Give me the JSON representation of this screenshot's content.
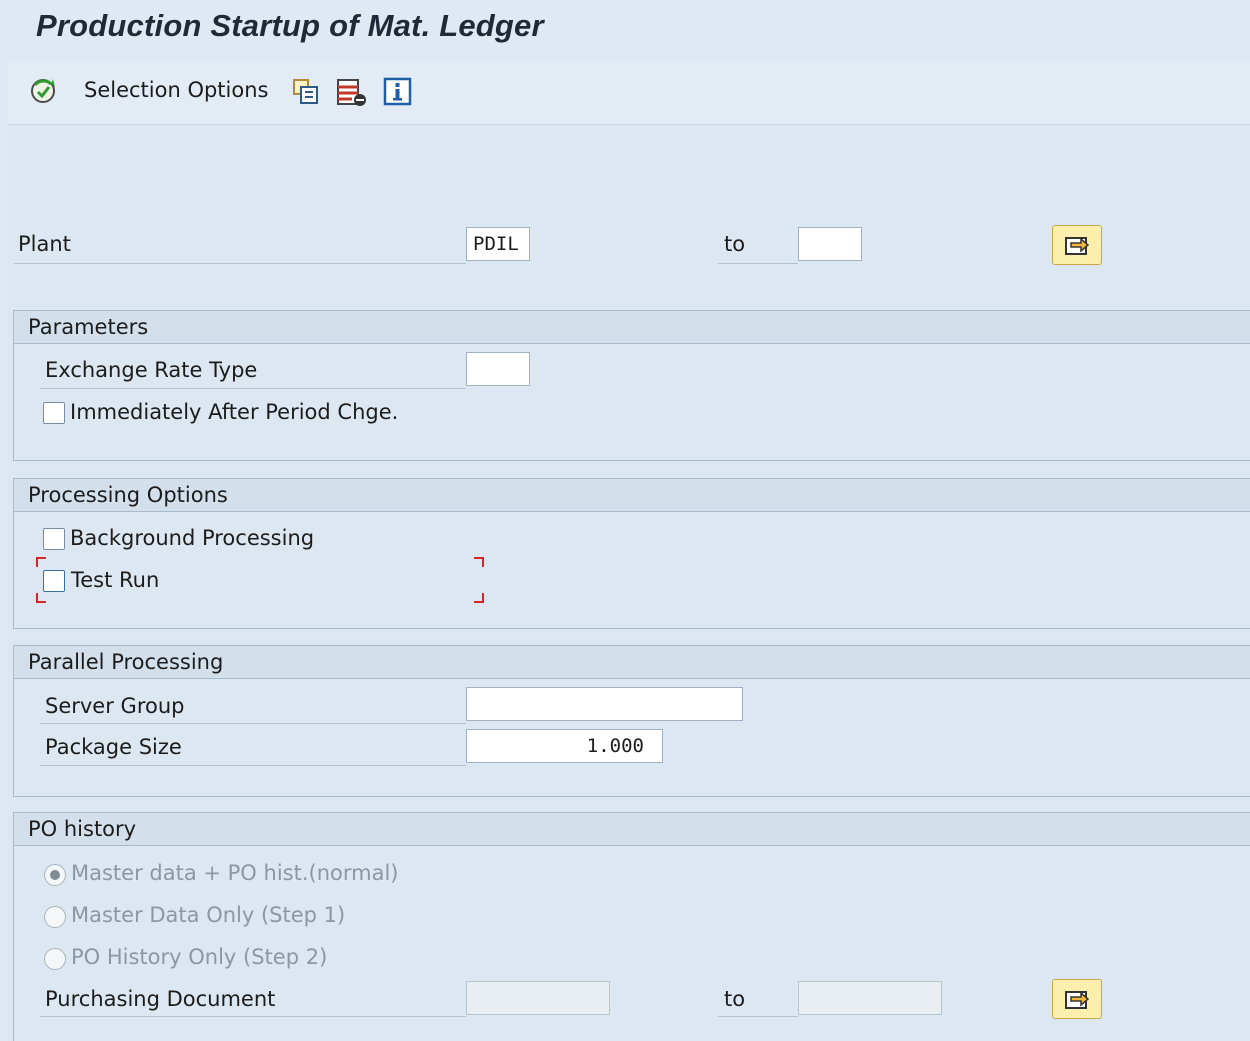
{
  "window": {
    "title": "Production Startup of Mat. Ledger"
  },
  "toolbar": {
    "execute_icon": "execute-icon",
    "selection_options_label": "Selection Options",
    "icons": [
      "copy-variant-icon",
      "delete-variant-icon",
      "info-icon"
    ]
  },
  "selection": {
    "plant_label": "Plant",
    "plant_from": "PDIL",
    "plant_to_label": "to",
    "plant_to": ""
  },
  "parameters": {
    "header": "Parameters",
    "exchange_rate_label": "Exchange Rate Type",
    "exchange_rate_value": "",
    "immediately_label": "Immediately After Period Chge.",
    "immediately_checked": false
  },
  "processing": {
    "header": "Processing Options",
    "background_label": "Background Processing",
    "background_checked": false,
    "testrun_label": "Test Run",
    "testrun_checked": false
  },
  "parallel": {
    "header": "Parallel Processing",
    "server_group_label": "Server Group",
    "server_group_value": "",
    "package_size_label": "Package Size",
    "package_size_value": "1.000"
  },
  "po_history": {
    "header": "PO history",
    "radio_master_po": "Master data + PO hist.(normal)",
    "radio_master_only": "Master Data Only (Step 1)",
    "radio_po_only": "PO History Only (Step 2)",
    "selected": "radio_master_po",
    "purch_doc_label": "Purchasing Document",
    "purch_doc_from": "",
    "purch_doc_to_label": "to",
    "purch_doc_to": ""
  },
  "colors": {
    "background": "#dfe9f3",
    "accent": "#1f5fa8",
    "focus_marker": "#d42828",
    "multi_select": "#fcefae"
  }
}
